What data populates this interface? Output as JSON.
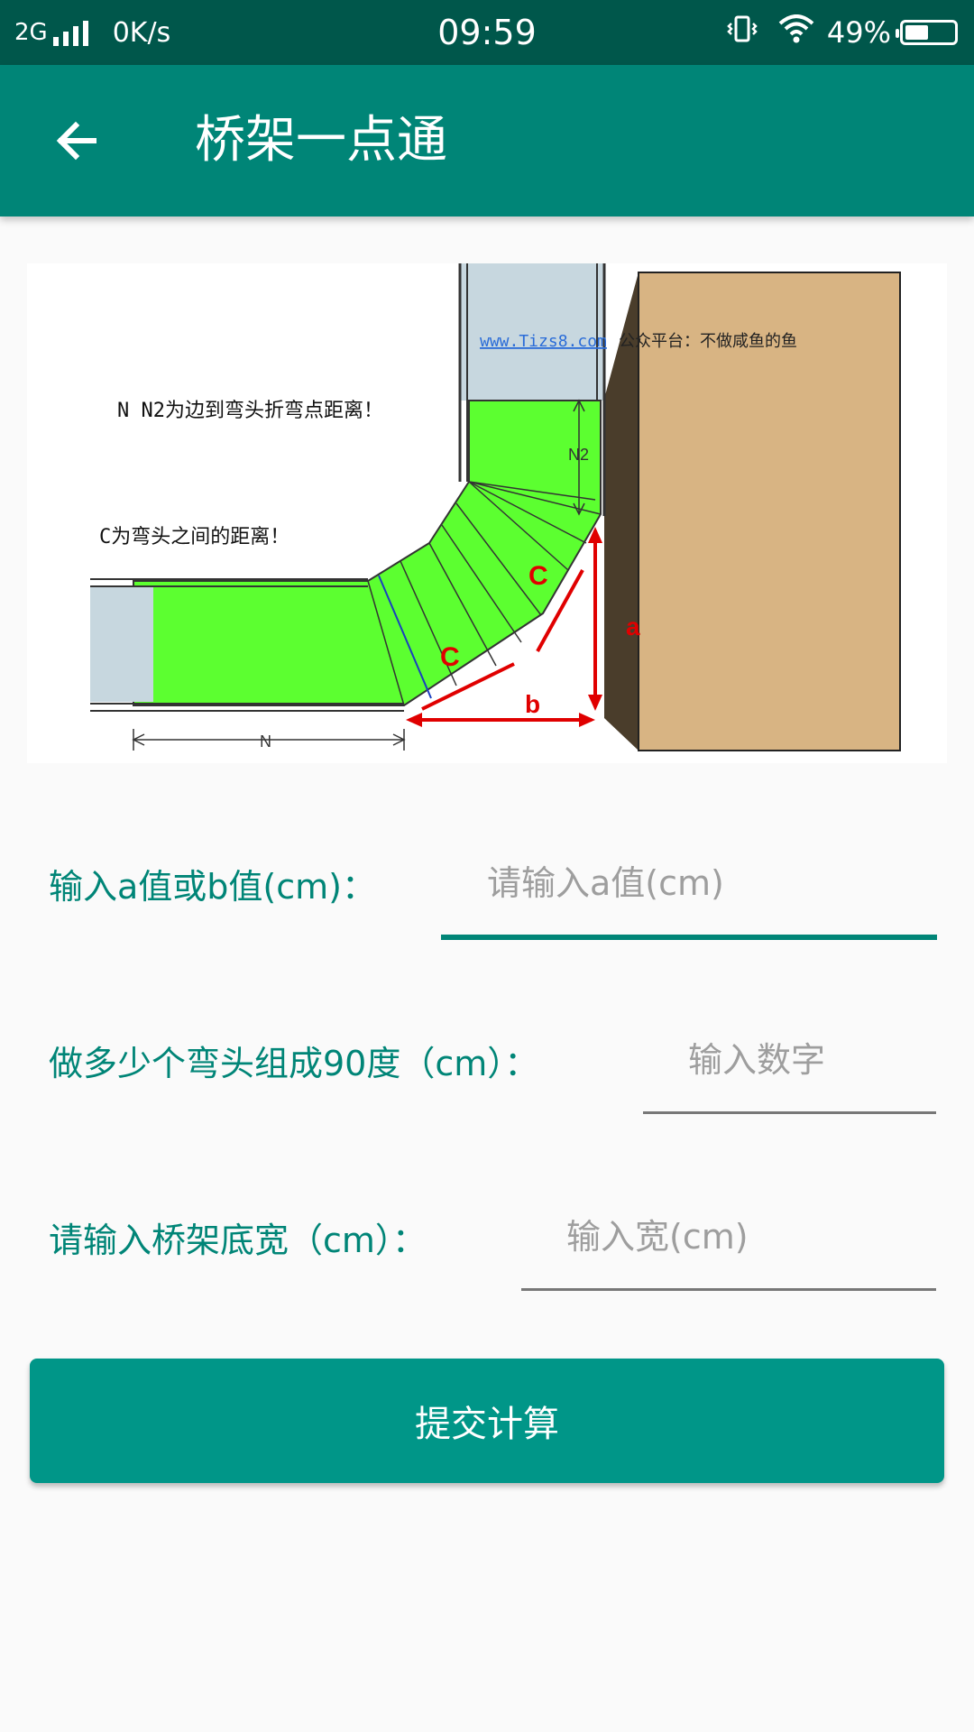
{
  "status_bar": {
    "network": "2G",
    "speed": "0K/s",
    "time": "09:59",
    "battery": "49%",
    "battery_level": 0.49,
    "icons": [
      "signal-icon",
      "vibrate-icon",
      "wifi-icon",
      "battery-icon"
    ]
  },
  "app_bar": {
    "title": "桥架一点通",
    "back_icon": "arrow-left-icon"
  },
  "diagram": {
    "watermark_url": "www.Tizs8.com",
    "watermark_text": "公众平台：不做咸鱼的鱼",
    "note_n": "N N2为边到弯头折弯点距离！",
    "note_c": "C为弯头之间的距离！",
    "label_n2": "N2",
    "label_c": "C",
    "label_a": "a",
    "label_b": "b",
    "label_n": "N"
  },
  "form": {
    "field_ab": {
      "label": "输入a值或b值(cm)：",
      "placeholder": "请输入a值(cm)",
      "value": ""
    },
    "field_count": {
      "label": "做多少个弯头组成90度（cm）：",
      "placeholder": "输入数字",
      "value": ""
    },
    "field_width": {
      "label": "请输入桥架底宽（cm）：",
      "placeholder": "输入宽(cm)",
      "value": ""
    }
  },
  "submit": {
    "label": "提交计算"
  },
  "colors": {
    "status_bar": "#00574b",
    "app_bar": "#008577",
    "accent": "#008577",
    "button": "#009688",
    "tray_green": "#5cff30",
    "wall": "#d8b483"
  }
}
